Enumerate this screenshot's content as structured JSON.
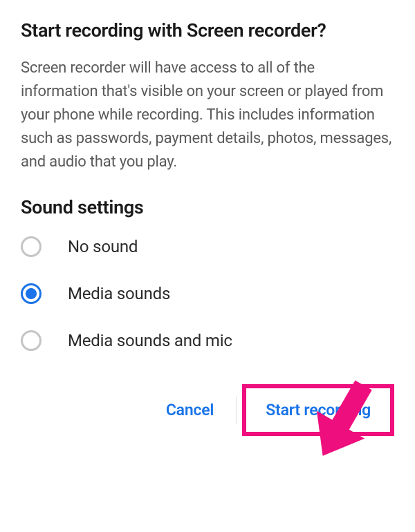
{
  "dialog": {
    "title": "Start recording with Screen recorder?",
    "description": "Screen recorder will have access to all of the information that's visible on your screen or played from your phone while recording. This includes information such as passwords, payment details, photos, messages, and audio that you play."
  },
  "sound_settings": {
    "heading": "Sound settings",
    "options": [
      {
        "label": "No sound",
        "selected": false
      },
      {
        "label": "Media sounds",
        "selected": true
      },
      {
        "label": "Media sounds and mic",
        "selected": false
      }
    ]
  },
  "buttons": {
    "cancel": "Cancel",
    "start": "Start recording"
  },
  "colors": {
    "accent": "#1a73e8",
    "highlight": "#ef0e7d"
  }
}
